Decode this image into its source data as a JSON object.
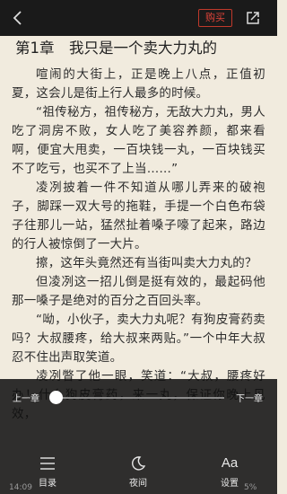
{
  "topbar": {
    "buy_label": "购买"
  },
  "chapter": {
    "title": "第1章　我只是一个卖大力丸的",
    "paragraphs": [
      "喧闹的大街上，正是晚上八点，正值初夏，这会儿是街上行人最多的时候。",
      "“祖传秘方，祖传秘方，无敌大力丸，男人吃了洞房不败，女人吃了美容养颜，都来看啊，便宜大甩卖，一百块钱一丸，一百块钱买不了吃亏，也买不了上当……”",
      "凌冽披着一件不知道从哪儿弄来的破袍子，脚踩一双大号的拖鞋，手提一个白色布袋子往那儿一站，猛然扯着嗓子嚎了起来，路边的行人被惊倒了一大片。",
      "擦，这年头竟然还有当街叫卖大力丸的？",
      "但凌冽这一招儿倒是挺有效的，最起码他那一嗓子是绝对的百分之百回头率。",
      "“呦，小伙子，卖大力丸呢？有狗皮膏药卖吗？大叔腰疼，给大叔来两贴。”一个中年大叔忍不住出声取笑道。",
      "凌冽瞥了他一眼，笑道：“大叔，腰疼好办！什么狗皮膏药，来一丸，保证你晚上见效，"
    ]
  },
  "reader_controls": {
    "prev_chapter_label": "上一章",
    "next_chapter_label": "下一章",
    "progress": 0.0,
    "menu": [
      {
        "label": "目录",
        "icon": "menu-list-icon"
      },
      {
        "label": "夜间",
        "icon": "moon-icon"
      },
      {
        "label": "设置",
        "icon": "font-settings-icon"
      }
    ]
  },
  "status": {
    "time": "14:09",
    "battery": "5%"
  }
}
